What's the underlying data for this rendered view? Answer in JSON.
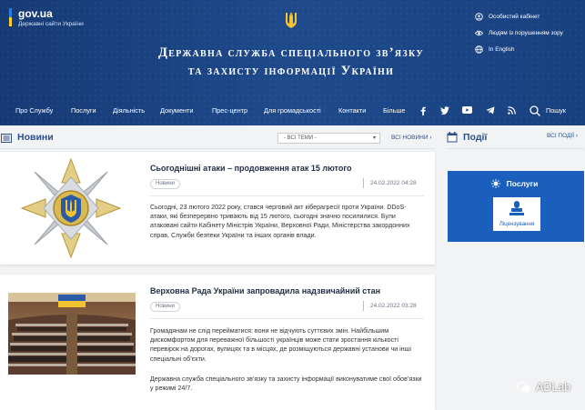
{
  "header": {
    "logo_name": "gov.ua",
    "logo_sub": "Державні сайти України",
    "title_line1": "Державна служба спеціального зв’язку",
    "title_line2": "та захисту інформації України",
    "top_links": [
      "Особистий кабінет",
      "Людям із порушенням зору",
      "In English"
    ]
  },
  "nav": {
    "items": [
      "Про Службу",
      "Послуги",
      "Діяльність",
      "Документи",
      "Прес-центр",
      "Для громадськості",
      "Контакти",
      "Більше"
    ],
    "search": "Пошук",
    "social_icons": [
      "facebook-icon",
      "twitter-icon",
      "youtube-icon",
      "telegram-icon",
      "rss-icon"
    ]
  },
  "news": {
    "heading": "Новини",
    "filter_value": "- ВСІ ТЕМИ -",
    "all_link": "ВСІ НОВИНИ ›",
    "items": [
      {
        "title": "Сьогоднішні атаки – продовження атак 15 лютого",
        "tag": "Новини",
        "date": "24.02.2022 04:28",
        "paragraphs": [
          "Сьогодні, 23 лютого 2022 року, стався черговий акт кібер­агресії проти України. DDoS-атаки, які безперервно тривають від 15 лютого, сьогодні значно посилилися. Були атаковані сайти Кабінету Міністрів України, Верховної Ради, Міністерства закордонних справ, Служби безпеки України та інших органів влади."
        ]
      },
      {
        "title": "Верховна Рада України запровадила надзвичайний стан",
        "tag": "Новини",
        "date": "24.02.2022 03:28",
        "paragraphs": [
          "Громадянам не слід перейматися: вони не відчують суттєвих змін. Найбільшим дискомфортом для переважної більшості українців може стати зростання кількості перевірок на дорогах, вулицях та в місцях, де розміщуються державні установи чи інші спеціальні об’єкти.",
          "Державна служба спеціального зв’язку та захисту інформації виконуватиме свої обов’язки у режимі 24/7."
        ]
      }
    ]
  },
  "events": {
    "heading": "Події",
    "all_link": "ВСІ ПОДІЇ ›"
  },
  "services": {
    "heading": "Послуги",
    "tile_label": "Ліцензування"
  },
  "watermark": "ADLab",
  "colors": {
    "header_bg": "#1e4a8c",
    "accent": "#1b5fbd",
    "link": "#2a4f8c"
  }
}
